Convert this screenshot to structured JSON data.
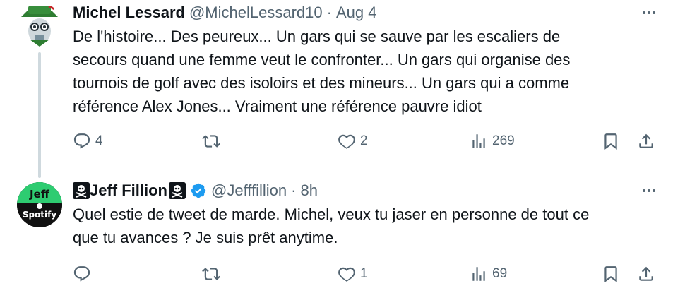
{
  "tweets": [
    {
      "name": "Michel Lessard",
      "handle": "@MichelLessard10",
      "separator": "·",
      "time": "Aug 4",
      "text": "De l'histoire... Des peureux... Un gars qui se sauve par les escaliers de\nsecours quand une femme veut le confronter... Un gars qui organise des\ntournois de golf avec des isoloirs et des mineurs... Un gars qui a comme\nréférence Alex Jones... Vraiment une référence pauvre idiot",
      "replies": "4",
      "retweets": "",
      "likes": "2",
      "views": "269"
    },
    {
      "name": "Jeff Fillion",
      "handle": "@Jefffillion",
      "separator": "·",
      "time": "8h",
      "text": "Quel estie de tweet de marde. Michel, veux tu jaser en personne de tout ce\nque tu avances ? Je suis prêt anytime.",
      "replies": "",
      "retweets": "",
      "likes": "1",
      "views": "69",
      "avatar_text_top": "Jeff",
      "avatar_text_bottom": "Spotify"
    }
  ],
  "colors": {
    "text": "#0f1419",
    "muted": "#536471",
    "verified": "#1d9bf0",
    "thread_line": "#cfd9de"
  }
}
